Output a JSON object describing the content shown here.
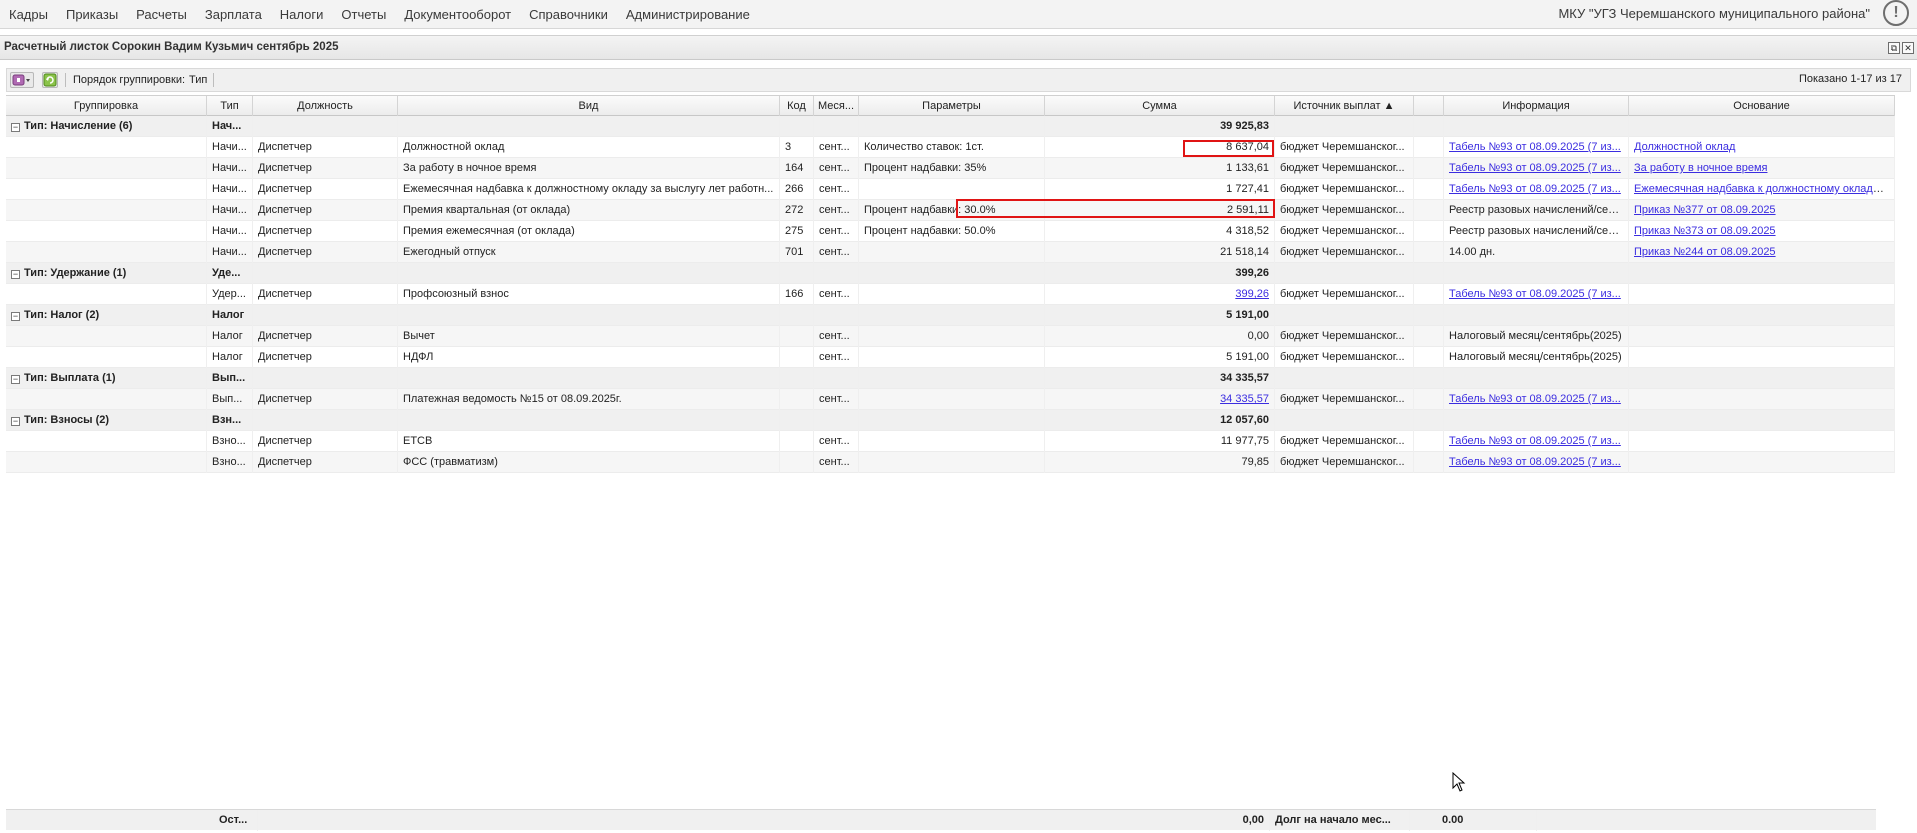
{
  "menu": {
    "items": [
      "Кадры",
      "Приказы",
      "Расчеты",
      "Зарплата",
      "Налоги",
      "Отчеты",
      "Документооборот",
      "Справочники",
      "Администрирование"
    ],
    "org": "МКУ \"УГЗ Черемшанского муниципального района\"",
    "info_icon": "!"
  },
  "window": {
    "title": "Расчетный листок Сорокин Вадим Кузьмич сентябрь 2025",
    "restore_icon": "⧉",
    "close_icon": "✕"
  },
  "toolbar": {
    "grouping_label": "Порядок группировки:",
    "grouping_value": "Тип",
    "shown": "Показано 1-17 из 17",
    "icons": [
      "add-dropdown-icon",
      "refresh-icon"
    ]
  },
  "columns": [
    "Группировка",
    "Тип",
    "Должность",
    "Вид",
    "Код",
    "Меся...",
    "Параметры",
    "Сумма",
    "Источник выплат ▲",
    "",
    "Информация",
    "Основание"
  ],
  "rows": [
    {
      "kind": "group",
      "grouping": "Тип: Начисление (6)",
      "type": "Нач...",
      "sum": "39 925,83"
    },
    {
      "kind": "data",
      "type": "Начи...",
      "position": "Диспетчер",
      "vid": "Должностной оклад",
      "code": "3",
      "month": "сент...",
      "params": "Количество ставок: 1ст.",
      "sum": "8 637,04",
      "sum_link": false,
      "source": "бюджет Черемшанског...",
      "info": "Табель №93 от 08.09.2025 (7 из...",
      "info_link": true,
      "basis": "Должностной оклад",
      "basis_link": true
    },
    {
      "kind": "data",
      "type": "Начи...",
      "position": "Диспетчер",
      "vid": "За работу в ночное время",
      "code": "164",
      "month": "сент...",
      "params": "Процент надбавки: 35%",
      "sum": "1 133,61",
      "sum_link": false,
      "source": "бюджет Черемшанског...",
      "info": "Табель №93 от 08.09.2025 (7 из...",
      "info_link": true,
      "basis": "За работу в ночное время",
      "basis_link": true
    },
    {
      "kind": "data",
      "type": "Начи...",
      "position": "Диспетчер",
      "vid": "Ежемесячная надбавка к должностному окладу за выслугу лет работн...",
      "code": "266",
      "month": "сент...",
      "params": "",
      "sum": "1 727,41",
      "sum_link": false,
      "source": "бюджет Черемшанског...",
      "info": "Табель №93 от 08.09.2025 (7 из...",
      "info_link": true,
      "basis": "Ежемесячная надбавка к должностному окладу з...",
      "basis_link": true
    },
    {
      "kind": "data",
      "type": "Начи...",
      "position": "Диспетчер",
      "vid": "Премия квартальная (от оклада)",
      "code": "272",
      "month": "сент...",
      "params": "Процент надбавки: 30.0%",
      "sum": "2 591,11",
      "sum_link": false,
      "source": "бюджет Черемшанског...",
      "info": "Реестр разовых начислений/сен...",
      "info_link": false,
      "basis": "Приказ №377 от 08.09.2025",
      "basis_link": true
    },
    {
      "kind": "data",
      "type": "Начи...",
      "position": "Диспетчер",
      "vid": "Премия ежемесячная (от оклада)",
      "code": "275",
      "month": "сент...",
      "params": "Процент надбавки: 50.0%",
      "sum": "4 318,52",
      "sum_link": false,
      "source": "бюджет Черемшанског...",
      "info": "Реестр разовых начислений/сен...",
      "info_link": false,
      "basis": "Приказ №373 от 08.09.2025",
      "basis_link": true
    },
    {
      "kind": "data",
      "type": "Начи...",
      "position": "Диспетчер",
      "vid": "Ежегодный отпуск",
      "code": "701",
      "month": "сент...",
      "params": "",
      "sum": "21 518,14",
      "sum_link": false,
      "source": "бюджет Черемшанског...",
      "info": "14.00 дн.",
      "info_link": false,
      "basis": "Приказ №244 от 08.09.2025",
      "basis_link": true
    },
    {
      "kind": "group",
      "grouping": "Тип: Удержание (1)",
      "type": "Уде...",
      "sum": "399,26"
    },
    {
      "kind": "data",
      "type": "Удер...",
      "position": "Диспетчер",
      "vid": "Профсоюзный взнос",
      "code": "166",
      "month": "сент...",
      "params": "",
      "sum": "399,26",
      "sum_link": true,
      "source": "бюджет Черемшанског...",
      "info": "Табель №93 от 08.09.2025 (7 из...",
      "info_link": true,
      "basis": "",
      "basis_link": false
    },
    {
      "kind": "group",
      "grouping": "Тип: Налог (2)",
      "type": "Налог",
      "sum": "5 191,00"
    },
    {
      "kind": "data",
      "type": "Налог",
      "position": "Диспетчер",
      "vid": "Вычет",
      "code": "",
      "month": "сент...",
      "params": "",
      "sum": "0,00",
      "sum_link": false,
      "source": "бюджет Черемшанског...",
      "info": "Налоговый месяц/сентябрь(2025)",
      "info_link": false,
      "basis": "",
      "basis_link": false
    },
    {
      "kind": "data",
      "type": "Налог",
      "position": "Диспетчер",
      "vid": "НДФЛ",
      "code": "",
      "month": "сент...",
      "params": "",
      "sum": "5 191,00",
      "sum_link": false,
      "source": "бюджет Черемшанског...",
      "info": "Налоговый месяц/сентябрь(2025)",
      "info_link": false,
      "basis": "",
      "basis_link": false
    },
    {
      "kind": "group",
      "grouping": "Тип: Выплата (1)",
      "type": "Вып...",
      "sum": "34 335,57"
    },
    {
      "kind": "data",
      "type": "Вып...",
      "position": "Диспетчер",
      "vid": "Платежная ведомость №15 от 08.09.2025г.",
      "code": "",
      "month": "сент...",
      "params": "",
      "sum": "34 335,57",
      "sum_link": true,
      "source": "бюджет Черемшанског...",
      "info": "Табель №93 от 08.09.2025 (7 из...",
      "info_link": true,
      "basis": "",
      "basis_link": false
    },
    {
      "kind": "group",
      "grouping": "Тип: Взносы (2)",
      "type": "Взн...",
      "sum": "12 057,60"
    },
    {
      "kind": "data",
      "type": "Взно...",
      "position": "Диспетчер",
      "vid": "ЕТСВ",
      "code": "",
      "month": "сент...",
      "params": "",
      "sum": "11 977,75",
      "sum_link": false,
      "source": "бюджет Черемшанског...",
      "info": "Табель №93 от 08.09.2025 (7 из...",
      "info_link": true,
      "basis": "",
      "basis_link": false
    },
    {
      "kind": "data",
      "type": "Взно...",
      "position": "Диспетчер",
      "vid": "ФСС (травматизм)",
      "code": "",
      "month": "сент...",
      "params": "",
      "sum": "79,85",
      "sum_link": false,
      "source": "бюджет Черемшанског...",
      "info": "Табель №93 от 08.09.2025 (7 из...",
      "info_link": true,
      "basis": "",
      "basis_link": false
    }
  ],
  "footer": {
    "type": "Ост...",
    "sum": "0,00",
    "debt_label": "Долг на начало мес...",
    "debt_value": "0.00"
  },
  "colors": {
    "highlight": "#e01414",
    "link": "#3b2de0"
  }
}
